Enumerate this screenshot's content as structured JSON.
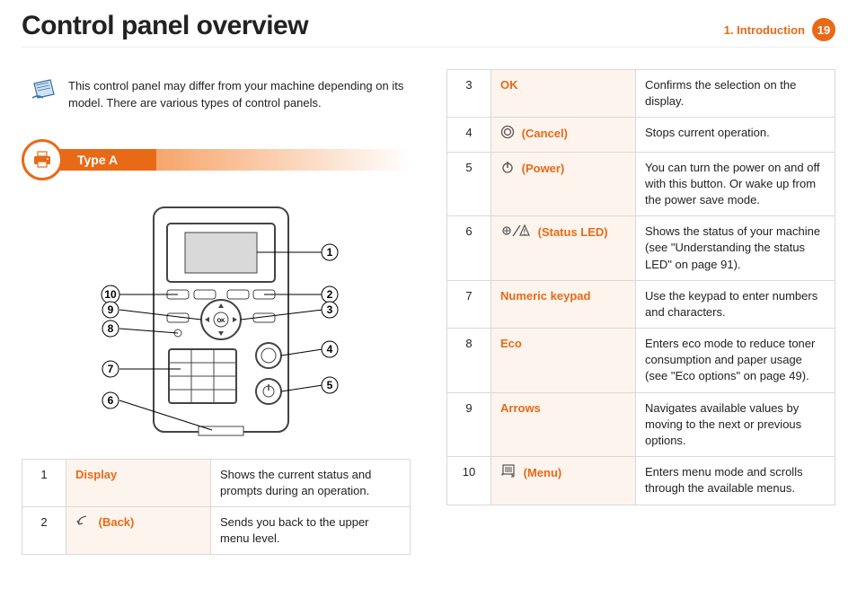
{
  "header": {
    "title": "Control panel overview",
    "crumb": "1.  Introduction",
    "page": "19"
  },
  "note": "This control panel may differ from your machine depending on its model. There are various types of control panels.",
  "section": {
    "label": "Type A"
  },
  "callouts": {
    "c1": "1",
    "c2": "2",
    "c3": "3",
    "c4": "4",
    "c5": "5",
    "c6": "6",
    "c7": "7",
    "c8": "8",
    "c9": "9",
    "c10": "10"
  },
  "tableLeft": [
    {
      "num": "1",
      "name": "Display",
      "icon": "",
      "desc": "Shows the current status and prompts during an operation."
    },
    {
      "num": "2",
      "name": "(Back)",
      "icon": "back",
      "desc": "Sends you back to the upper menu level."
    }
  ],
  "tableRight": [
    {
      "num": "3",
      "name": "OK",
      "icon": "",
      "desc": "Confirms the selection on the display."
    },
    {
      "num": "4",
      "name": "(Cancel)",
      "icon": "cancel",
      "desc": "Stops current operation."
    },
    {
      "num": "5",
      "name": "(Power)",
      "icon": "power",
      "desc": "You can turn the power on and off with this button. Or wake up from the power save mode."
    },
    {
      "num": "6",
      "name": "(Status LED)",
      "icon": "status",
      "desc": "Shows the status of your machine (see \"Understanding the status LED\" on page 91)."
    },
    {
      "num": "7",
      "name": "Numeric keypad",
      "icon": "",
      "desc": "Use the keypad to enter numbers and characters."
    },
    {
      "num": "8",
      "name": "Eco",
      "icon": "",
      "desc": "Enters eco mode to reduce toner consumption and paper usage (see \"Eco options\" on page 49)."
    },
    {
      "num": "9",
      "name": "Arrows",
      "icon": "",
      "desc": "Navigates available values by moving to the next or previous options."
    },
    {
      "num": "10",
      "name": "(Menu)",
      "icon": "menu",
      "desc": "Enters menu mode and scrolls through the available menus."
    }
  ]
}
